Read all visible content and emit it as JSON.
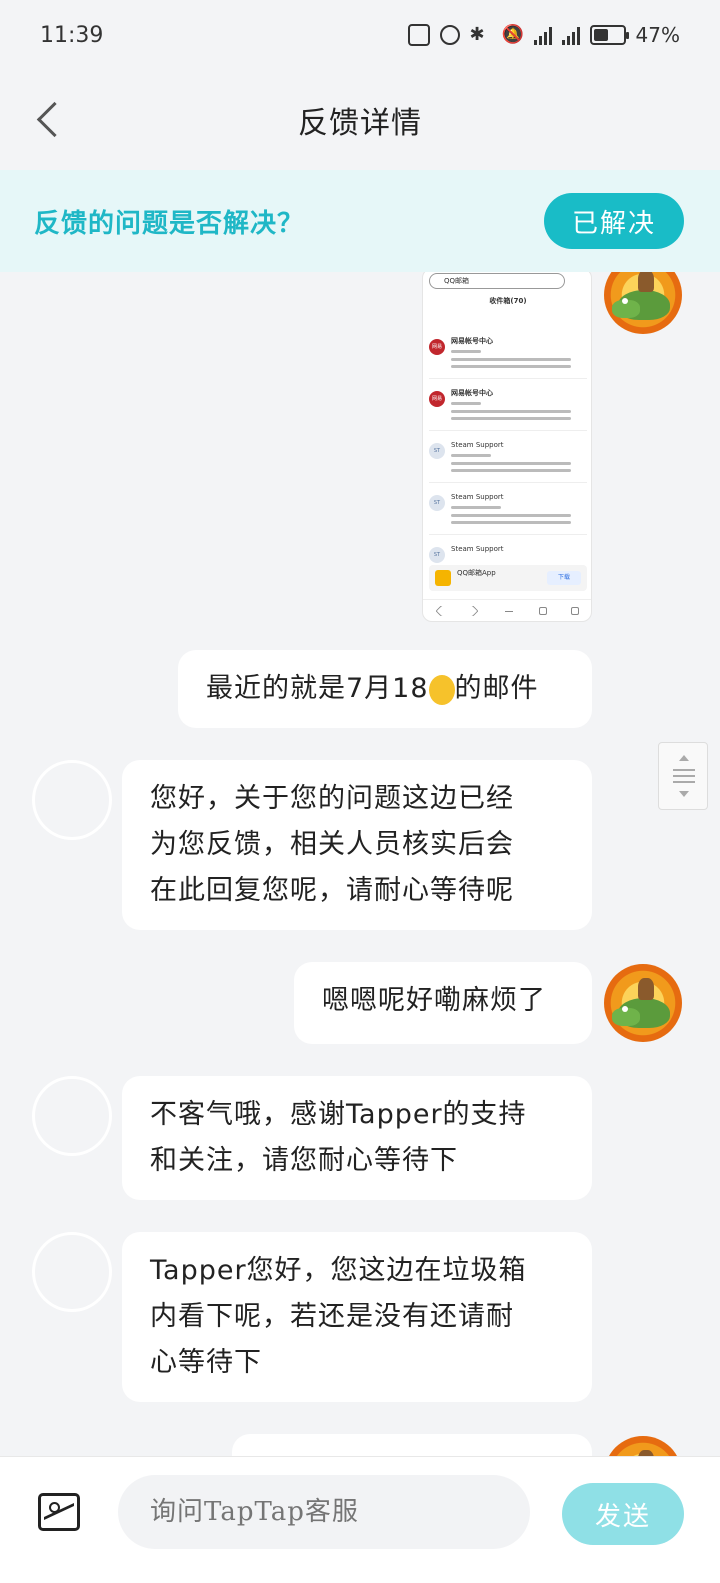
{
  "status_bar": {
    "time": "11:39",
    "battery": "47%"
  },
  "header": {
    "title": "反馈详情"
  },
  "banner": {
    "question": "反馈的问题是否解决？",
    "resolved_button": "已解决"
  },
  "attachment_screenshot": {
    "search_text": "QQ邮箱",
    "inbox_title": "收件箱(70)",
    "rows": [
      {
        "sender": "网易帐号中心",
        "avatar": "网易"
      },
      {
        "sender": "网易帐号中心",
        "avatar": "网易"
      },
      {
        "sender": "Steam Support",
        "avatar": "ST"
      },
      {
        "sender": "Steam Support",
        "avatar": "ST"
      },
      {
        "sender": "Steam Support",
        "avatar": "ST"
      }
    ],
    "promo_title": "QQ邮箱App",
    "promo_button": "下载"
  },
  "messages": [
    {
      "from": "user",
      "text_before": "最近的就是7月18",
      "text_after": "的邮件",
      "emoji": "ok-hand"
    },
    {
      "from": "support",
      "lines": [
        "您好，关于您的问题这边已经",
        "为您反馈，相关人员核实后会",
        "在此回复您呢，请耐心等待呢"
      ]
    },
    {
      "from": "user",
      "text": "嗯嗯呢好嘞麻烦了"
    },
    {
      "from": "support",
      "lines": [
        "不客气哦，感谢Tapper的支持",
        "和关注，请您耐心等待下"
      ]
    },
    {
      "from": "support",
      "lines": [
        "Tapper您好，您这边在垃圾箱",
        "内看下呢，若还是没有还请耐",
        "心等待下"
      ]
    }
  ],
  "composer": {
    "placeholder": "询问TapTap客服",
    "send_label": "发送"
  }
}
